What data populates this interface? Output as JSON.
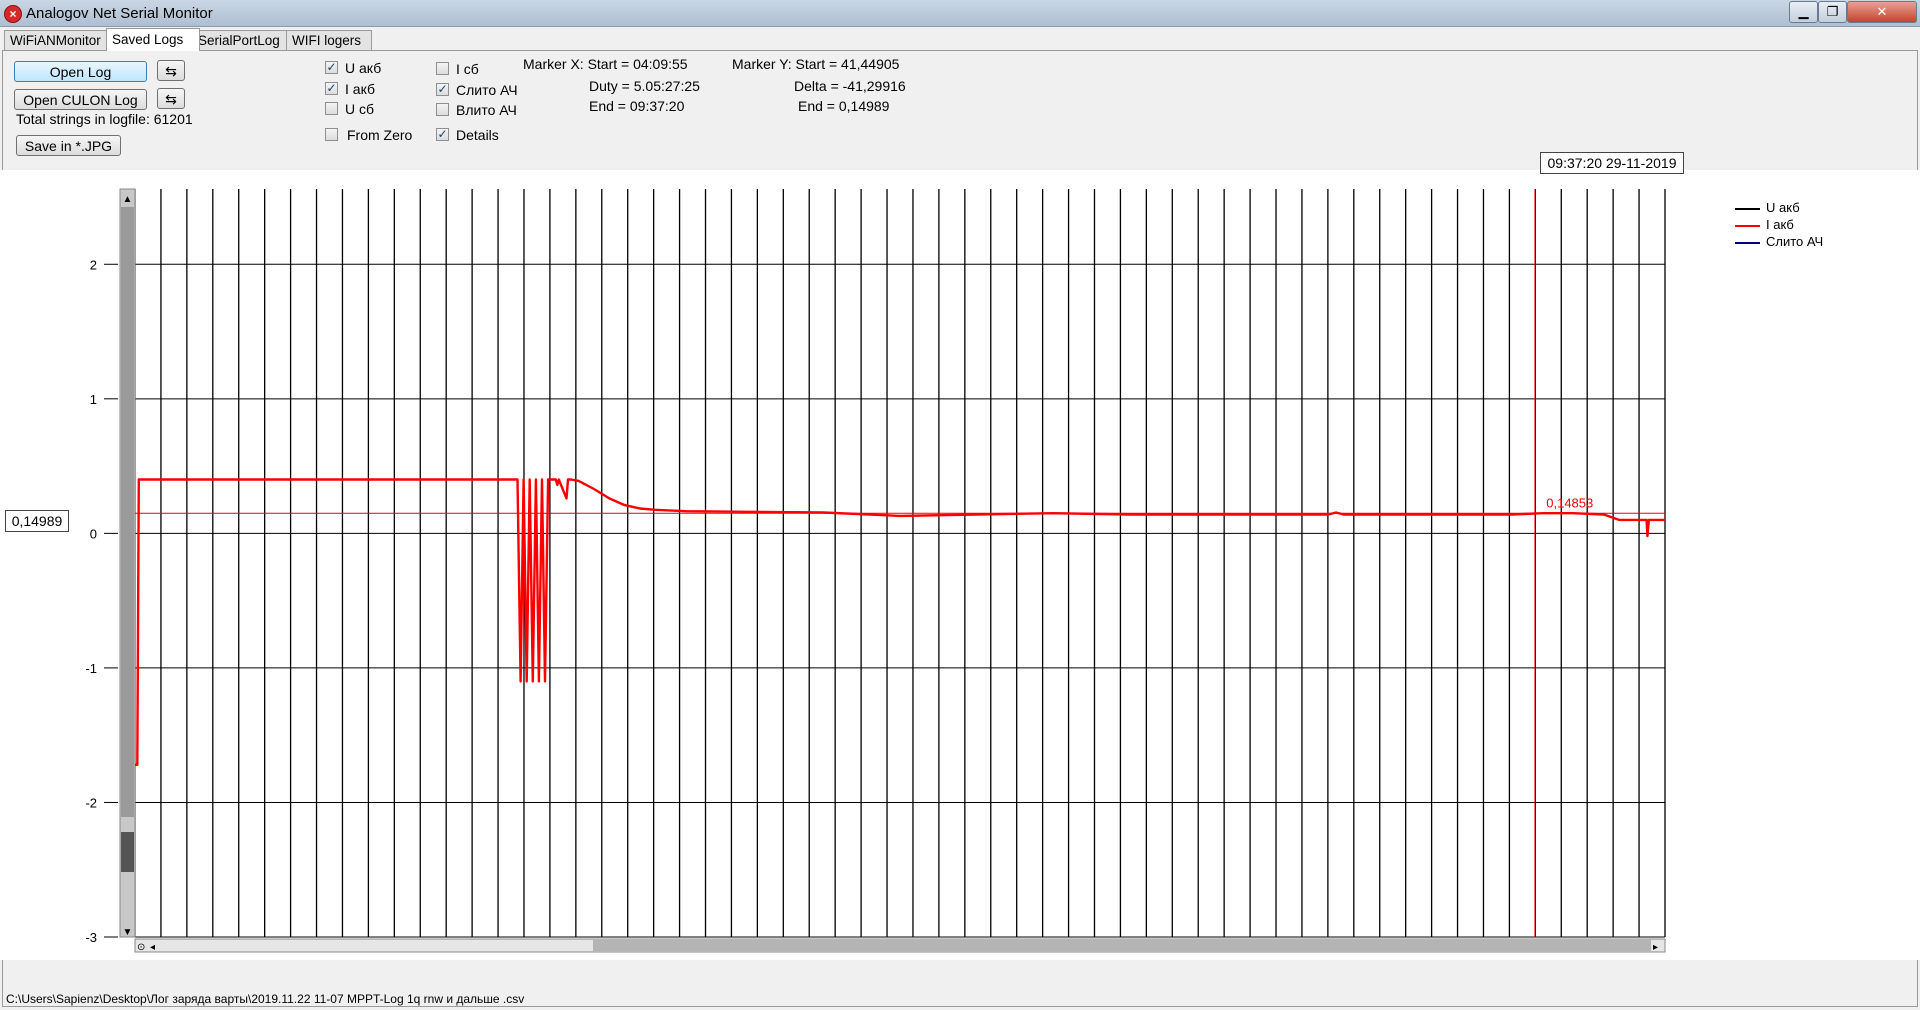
{
  "window": {
    "title": "Analogov Net Serial Monitor",
    "icon": "app-icon",
    "min_glyph": "▁",
    "max_glyph": "❐",
    "close_glyph": "✕"
  },
  "tabs": [
    {
      "label": "WiFiANMonitor",
      "active": false
    },
    {
      "label": "Saved Logs",
      "active": true
    },
    {
      "label": "SerialPortLog",
      "active": false
    },
    {
      "label": "WIFI logers",
      "active": false
    }
  ],
  "controls": {
    "open_log_label": "Open Log",
    "open_culon_label": "Open CULON Log",
    "reload_glyph": "⇆",
    "total_strings": "Total strings in logfile: 61201",
    "save_jpg_label": "Save in *.JPG"
  },
  "checkboxes": [
    {
      "label": "U акб",
      "checked": true
    },
    {
      "label": "I акб",
      "checked": true
    },
    {
      "label": "U сб",
      "checked": false
    },
    {
      "label": "From Zero",
      "checked": false
    },
    {
      "label": "I сб",
      "checked": false
    },
    {
      "label": "Слито АЧ",
      "checked": true
    },
    {
      "label": "Влито АЧ",
      "checked": false
    },
    {
      "label": "Details",
      "checked": true
    }
  ],
  "check_glyph": "✓",
  "markers": {
    "x_start": "Marker X: Start = 04:09:55",
    "x_duty": "Duty = 5.05:27:25",
    "x_end": "End  = 09:37:20",
    "y_start": "Marker Y: Start = 41,44905",
    "y_delta": "Delta = -41,29916",
    "y_end": "End  = 0,14989"
  },
  "timestamp": "09:37:20 29-11-2019",
  "cursor_value": "0,14989",
  "status_path": "C:\\Users\\Sapienz\\Desktop\\Лог заряда варты\\2019.11.22 11-07 MPPT-Log 1q rnw и дальше .csv",
  "colors": {
    "u_akb": "#000000",
    "i_akb": "#ff0000",
    "slito": "#000080",
    "grid": "#000000"
  },
  "chart_data": {
    "type": "line",
    "ylim": [
      -3,
      2.5
    ],
    "yticks": [
      {
        "value": 2,
        "label": "2"
      },
      {
        "value": 1,
        "label": "1"
      },
      {
        "value": 0,
        "label": "0"
      },
      {
        "value": -1,
        "label": "-1"
      },
      {
        "value": -2,
        "label": "-2"
      },
      {
        "value": -3,
        "label": "-3"
      }
    ],
    "xlim": [
      0,
      100
    ],
    "x_gridlines": 60,
    "marker_y_value": 0.14989,
    "marker_x_position": 91.5,
    "point_annotation": {
      "x": 92.5,
      "y": 0.14853,
      "label": "0,14853"
    },
    "legend_placement": "top-right",
    "series": [
      {
        "name": "U акб",
        "color": "#000000",
        "points": []
      },
      {
        "name": "I акб",
        "color": "#ff0000",
        "points": [
          [
            0,
            -1.72
          ],
          [
            0.15,
            -1.72
          ],
          [
            0.25,
            0.4
          ],
          [
            25,
            0.4
          ],
          [
            25.2,
            -1.1
          ],
          [
            25.4,
            0.4
          ],
          [
            25.6,
            -1.1
          ],
          [
            25.8,
            0.4
          ],
          [
            26.0,
            -1.1
          ],
          [
            26.2,
            0.4
          ],
          [
            26.4,
            -1.1
          ],
          [
            26.6,
            0.4
          ],
          [
            26.8,
            -1.1
          ],
          [
            27.0,
            0.4
          ],
          [
            27.5,
            0.4
          ],
          [
            27.6,
            0.36
          ],
          [
            27.7,
            0.4
          ],
          [
            28.2,
            0.26
          ],
          [
            28.3,
            0.4
          ],
          [
            28.5,
            0.4
          ],
          [
            29,
            0.39
          ],
          [
            30,
            0.33
          ],
          [
            31,
            0.26
          ],
          [
            32,
            0.21
          ],
          [
            33,
            0.185
          ],
          [
            34,
            0.175
          ],
          [
            36,
            0.165
          ],
          [
            40,
            0.16
          ],
          [
            45,
            0.155
          ],
          [
            50,
            0.13
          ],
          [
            55,
            0.14
          ],
          [
            60,
            0.15
          ],
          [
            65,
            0.14
          ],
          [
            70,
            0.14
          ],
          [
            75,
            0.14
          ],
          [
            78,
            0.14
          ],
          [
            78.5,
            0.155
          ],
          [
            79,
            0.14
          ],
          [
            85,
            0.14
          ],
          [
            90,
            0.14
          ],
          [
            92,
            0.15
          ],
          [
            94,
            0.15
          ],
          [
            96,
            0.14
          ],
          [
            97,
            0.1
          ],
          [
            98.8,
            0.1
          ],
          [
            98.85,
            -0.02
          ],
          [
            98.95,
            0.1
          ],
          [
            100,
            0.1
          ]
        ]
      },
      {
        "name": "Слито АЧ",
        "color": "#000080",
        "points": []
      }
    ]
  }
}
